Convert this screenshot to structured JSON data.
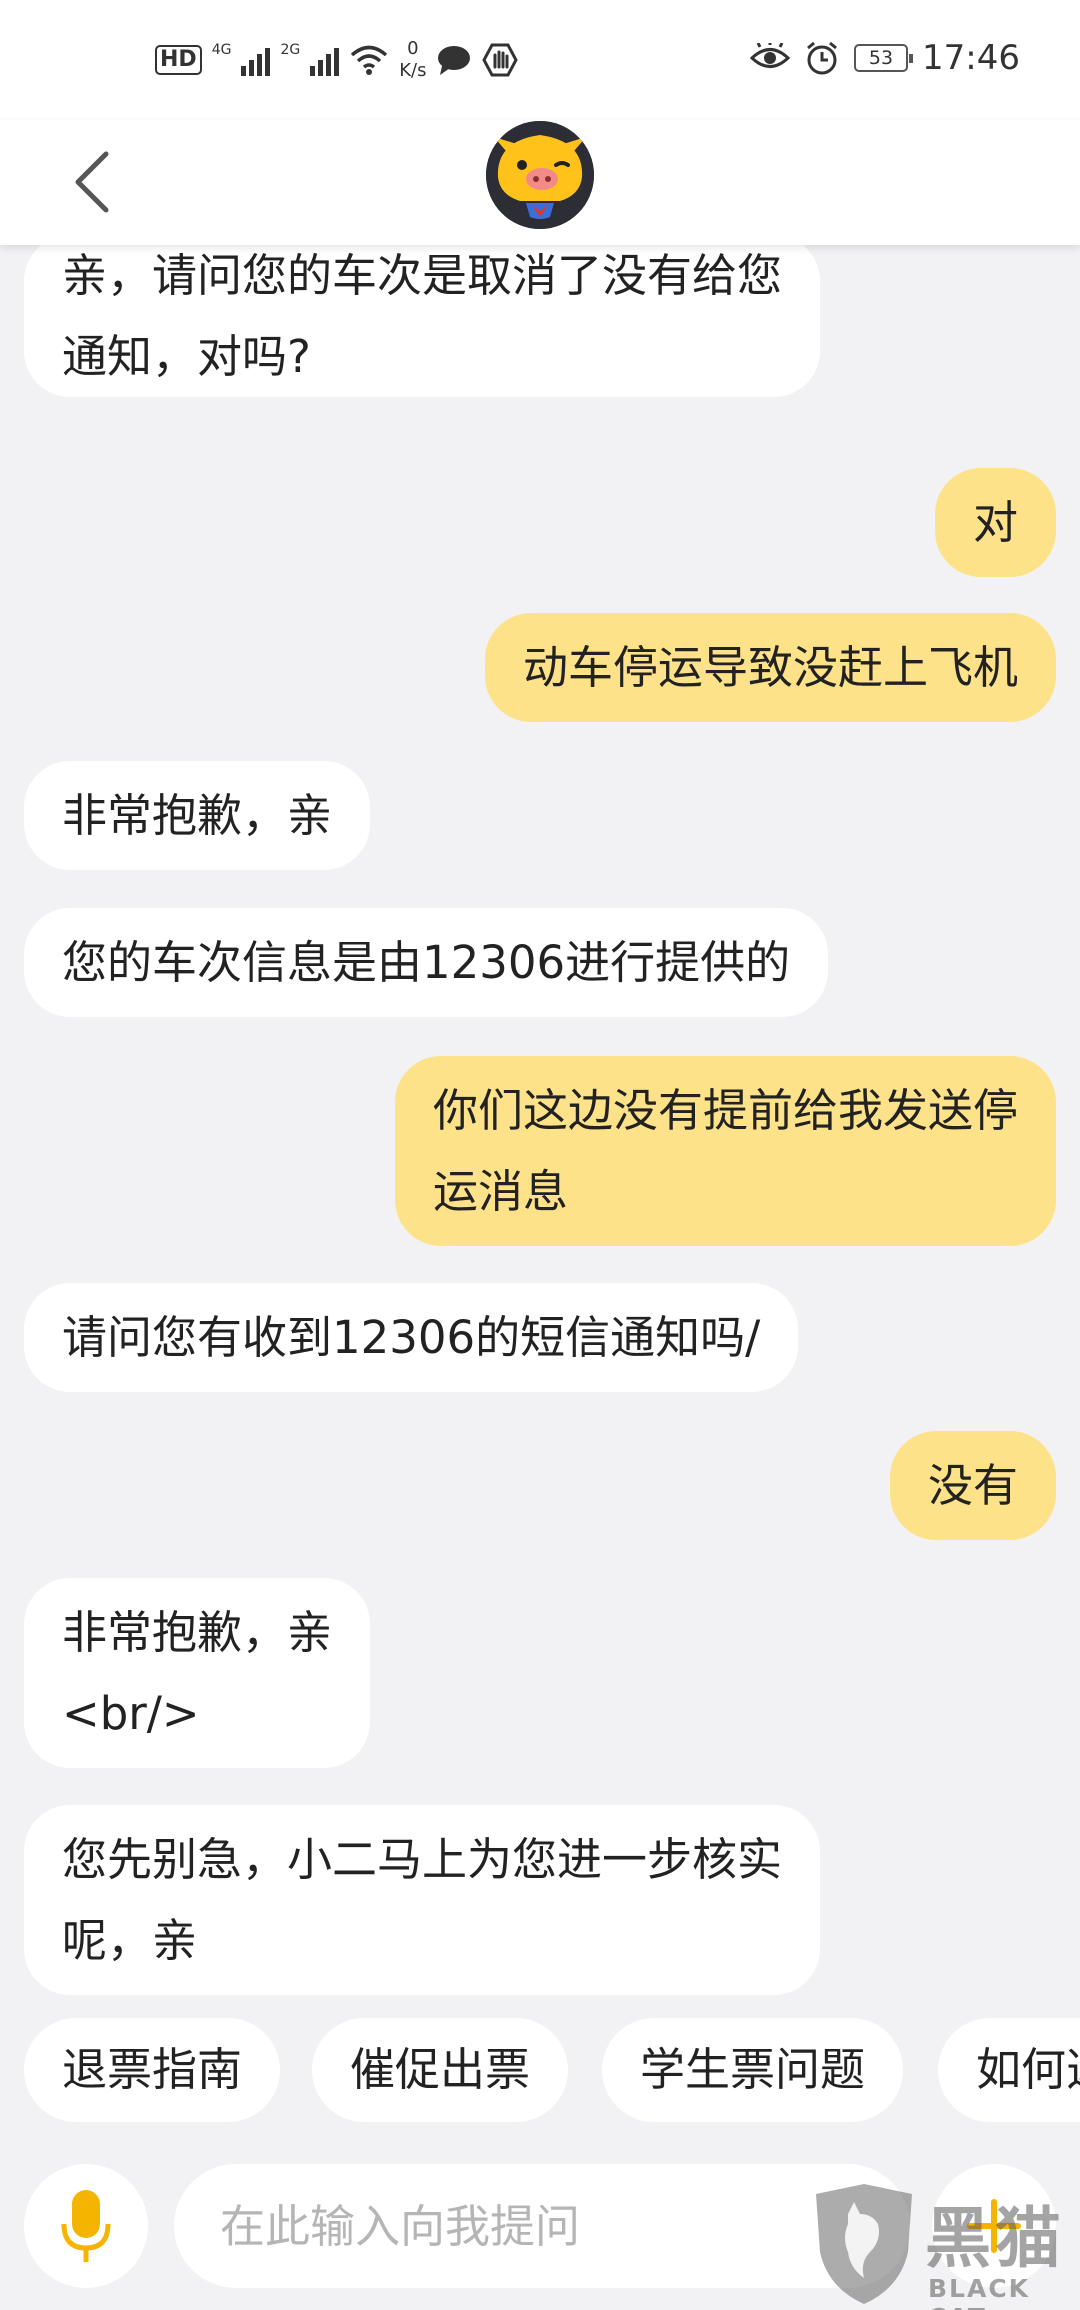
{
  "status_bar": {
    "hd_label": "HD",
    "sim1_network": "4G",
    "sim2_network": "2G",
    "speed_value": "0",
    "speed_unit": "K/s",
    "battery_level": "53",
    "time": "17:46"
  },
  "icons": {
    "back": "chevron-left-icon",
    "avatar": "pig-mascot-avatar",
    "mic": "microphone-icon",
    "plus": "plus-icon"
  },
  "colors": {
    "outgoing_bubble": "#fde28a",
    "incoming_bubble": "#ffffff",
    "background": "#f2f2f4",
    "accent": "#f5b400"
  },
  "messages": [
    {
      "side": "in",
      "lines": [
        "亲，请问您的车次是取消了没有给您",
        "通知，对吗?"
      ]
    },
    {
      "side": "out",
      "lines": [
        "对"
      ]
    },
    {
      "side": "out",
      "lines": [
        "动车停运导致没赶上飞机"
      ]
    },
    {
      "side": "in",
      "lines": [
        "非常抱歉，亲"
      ]
    },
    {
      "side": "in",
      "lines": [
        "您的车次信息是由12306进行提供的"
      ]
    },
    {
      "side": "out",
      "lines": [
        "你们这边没有提前给我发送停",
        "运消息"
      ]
    },
    {
      "side": "in",
      "lines": [
        "请问您有收到12306的短信通知吗/"
      ]
    },
    {
      "side": "out",
      "lines": [
        "没有"
      ]
    },
    {
      "side": "in",
      "lines": [
        "非常抱歉，亲",
        "<br/>"
      ]
    },
    {
      "side": "in",
      "lines": [
        "您先别急，小二马上为您进一步核实",
        "呢，亲"
      ]
    }
  ],
  "quick_replies": [
    "退票指南",
    "催促出票",
    "学生票问题",
    "如何选"
  ],
  "input": {
    "placeholder": "在此输入向我提问",
    "value": ""
  },
  "watermark": {
    "title": "黑猫",
    "subtitle": "BLACK CAT"
  }
}
